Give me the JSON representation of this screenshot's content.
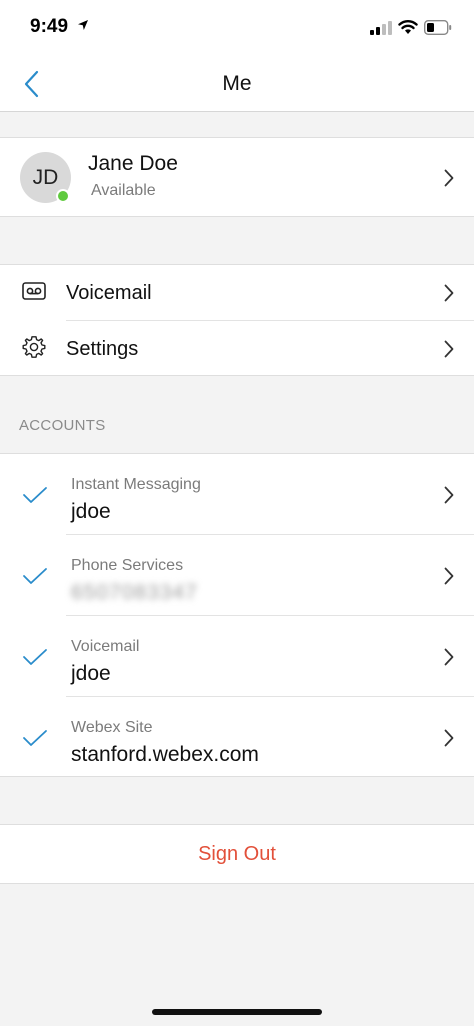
{
  "status_bar": {
    "time": "9:49"
  },
  "nav": {
    "title": "Me"
  },
  "profile": {
    "initials": "JD",
    "name": "Jane Doe",
    "status": "Available"
  },
  "menu": {
    "items": [
      {
        "label": "Voicemail",
        "icon": "voicemail-icon"
      },
      {
        "label": "Settings",
        "icon": "gear-icon"
      }
    ]
  },
  "accounts": {
    "header": "ACCOUNTS",
    "items": [
      {
        "title": "Instant Messaging",
        "value": "jdoe"
      },
      {
        "title": "Phone Services",
        "value": "6507083347"
      },
      {
        "title": "Voicemail",
        "value": "jdoe"
      },
      {
        "title": "Webex Site",
        "value": "stanford.webex.com"
      }
    ]
  },
  "actions": {
    "sign_out": "Sign Out"
  },
  "colors": {
    "accent": "#2a8ccb",
    "presence": "#5fca3e",
    "destructive": "#e2503a"
  }
}
